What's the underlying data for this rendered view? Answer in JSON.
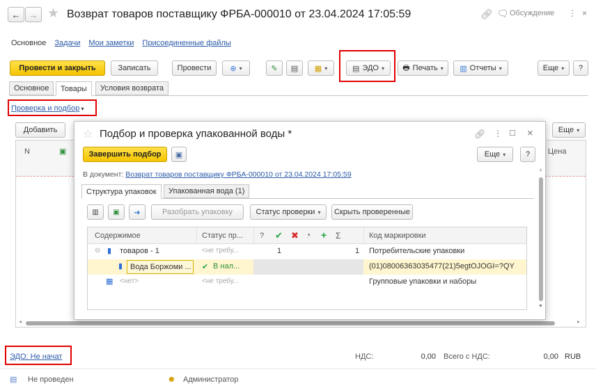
{
  "window": {
    "title": "Возврат товаров поставщику ФРБА-000010 от 23.04.2024 17:05:59",
    "discussion_label": "Обсуждение"
  },
  "nav_links": [
    "Основное",
    "Задачи",
    "Мои заметки",
    "Присоединенные файлы"
  ],
  "toolbar": {
    "post_close": "Провести и закрыть",
    "save": "Записать",
    "post": "Провести",
    "edo": "ЭДО",
    "print": "Печать",
    "reports": "Отчеты",
    "more": "Еще",
    "help": "?"
  },
  "tabs": [
    "Основное",
    "Товары",
    "Условия возврата"
  ],
  "check_link": "Проверка и подбор",
  "table": {
    "add": "Добавить",
    "more": "Еще",
    "col_n": "N",
    "col_price": "Цена"
  },
  "dialog": {
    "title": "Подбор и проверка упакованной воды *",
    "finish": "Завершить подбор",
    "more": "Еще",
    "help": "?",
    "doc_prefix": "В документ:",
    "doc_link": "Возврат товаров поставщику ФРБА-000010 от 23.04.2024 17:05:59",
    "tabs": [
      "Структура упаковок",
      "Упакованная вода (1)"
    ],
    "buttons": {
      "unpack": "Разобрать упаковку",
      "check_status": "Статус проверки",
      "hide_checked": "Скрыть проверенные"
    },
    "headers": {
      "content": "Содержимое",
      "status": "Статус пр...",
      "q": "?",
      "sum": "Σ",
      "code": "Код маркировки"
    },
    "rows": [
      {
        "content": "товаров - 1",
        "status": "<не требу...",
        "col1": "1",
        "sum": "1",
        "code": "Потребительские упаковки"
      },
      {
        "content": "Вода Боржоми ...",
        "status": "В нал...",
        "code": "(01)08006363035477(21)5egtOJOGI=?QY"
      },
      {
        "content": "<нет>",
        "status": "<не требу...",
        "code": "Групповые упаковки и наборы"
      }
    ]
  },
  "footer": {
    "edo_status": "ЭДО: Не начат",
    "vat_label": "НДС:",
    "vat_value": "0,00",
    "total_label": "Всего с НДС:",
    "total_value": "0,00",
    "currency": "RUB",
    "post_state": "Не проведен",
    "user": "Администратор"
  },
  "colors": {
    "accent_yellow": "#f5c400",
    "highlight_red": "#e00000",
    "link_blue": "#2a5aa8",
    "check_green": "#22a344",
    "cross_red": "#d62b2b"
  }
}
